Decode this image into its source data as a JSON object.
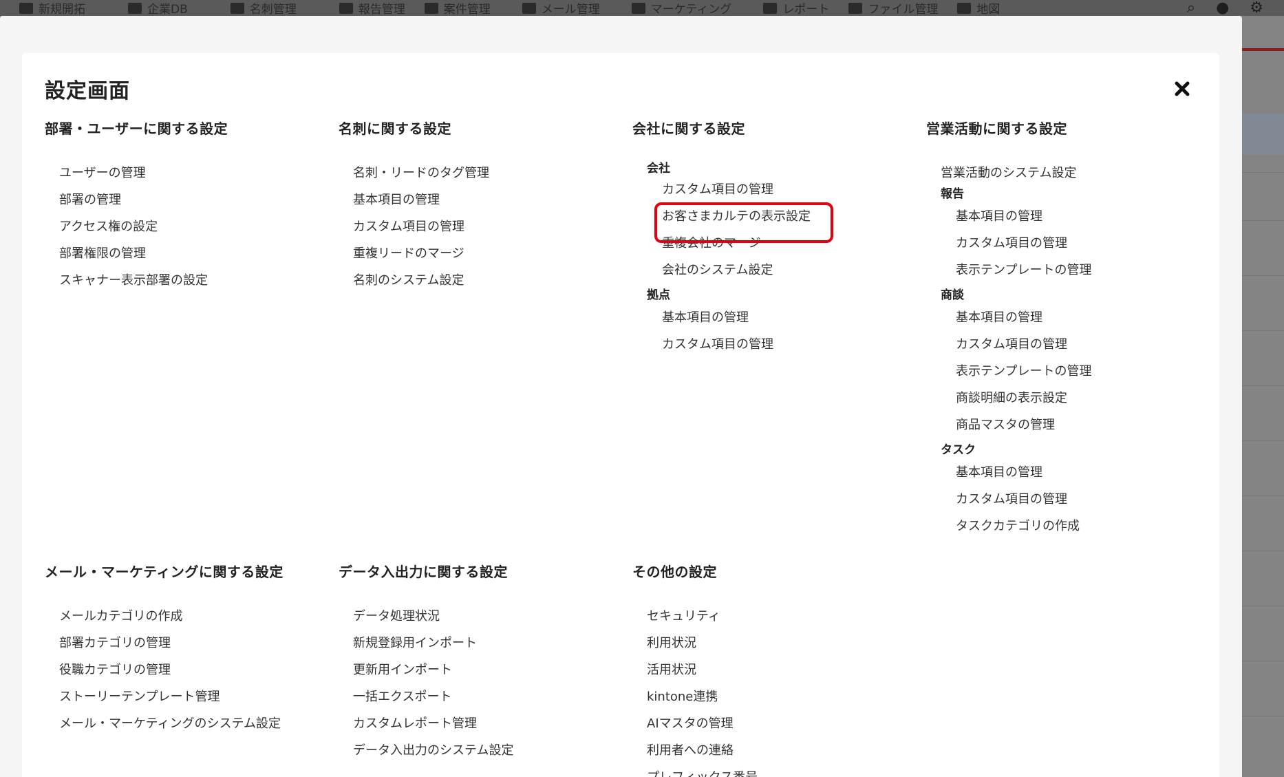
{
  "topnav": {
    "items": [
      "新規開拓",
      "企業DB",
      "名刺管理",
      "報告管理",
      "案件管理",
      "メール管理",
      "マーケティング",
      "レポート",
      "ファイル管理",
      "地図"
    ],
    "right_icons": [
      "search-icon",
      "bell-icon",
      "gear-icon"
    ]
  },
  "dialog": {
    "title": "設定画面",
    "close_icon": "close-icon"
  },
  "sections": {
    "dept_user": {
      "title": "部署・ユーザーに関する設定",
      "items": [
        "ユーザーの管理",
        "部署の管理",
        "アクセス権の設定",
        "部署権限の管理",
        "スキャナー表示部署の設定"
      ]
    },
    "meishi": {
      "title": "名刺に関する設定",
      "items": [
        "名刺・リードのタグ管理",
        "基本項目の管理",
        "カスタム項目の管理",
        "重複リードのマージ",
        "名刺のシステム設定"
      ]
    },
    "company": {
      "title": "会社に関する設定",
      "group1": "会社",
      "group1_items": [
        "カスタム項目の管理",
        "お客さまカルテの表示設定",
        "重複会社のマージ",
        "会社のシステム設定"
      ],
      "group2": "拠点",
      "group2_items": [
        "基本項目の管理",
        "カスタム項目の管理"
      ]
    },
    "sales": {
      "title": "営業活動に関する設定",
      "top_item": "営業活動のシステム設定",
      "group1": "報告",
      "group1_items": [
        "基本項目の管理",
        "カスタム項目の管理",
        "表示テンプレートの管理"
      ],
      "group2": "商談",
      "group2_items": [
        "基本項目の管理",
        "カスタム項目の管理",
        "表示テンプレートの管理",
        "商談明細の表示設定",
        "商品マスタの管理"
      ],
      "group3": "タスク",
      "group3_items": [
        "基本項目の管理",
        "カスタム項目の管理",
        "タスクカテゴリの作成"
      ]
    },
    "mail_marketing": {
      "title": "メール・マーケティングに関する設定",
      "items": [
        "メールカテゴリの作成",
        "部署カテゴリの管理",
        "役職カテゴリの管理",
        "ストーリーテンプレート管理",
        "メール・マーケティングのシステム設定"
      ]
    },
    "data_io": {
      "title": "データ入出力に関する設定",
      "items": [
        "データ処理状況",
        "新規登録用インポート",
        "更新用インポート",
        "一括エクスポート",
        "カスタムレポート管理",
        "データ入出力のシステム設定"
      ]
    },
    "other": {
      "title": "その他の設定",
      "items": [
        "セキュリティ",
        "利用状況",
        "活用状況",
        "kintone連携",
        "AIマスタの管理",
        "利用者への連絡",
        "プレフィックス番号"
      ]
    }
  },
  "colors": {
    "highlight_border": "#e3000f",
    "overlay_bg": "#f5f5f5",
    "dialog_bg": "#ffffff"
  }
}
